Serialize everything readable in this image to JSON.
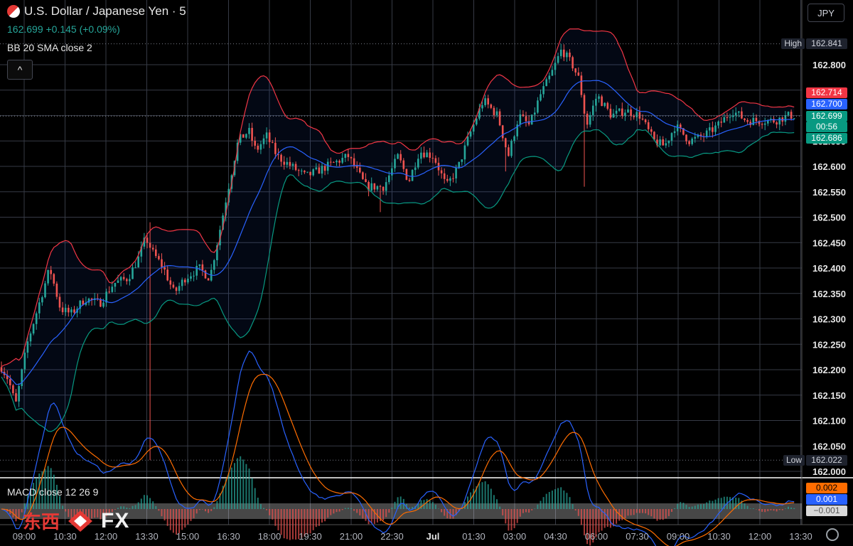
{
  "header": {
    "symbol": "U.S. Dollar / Japanese Yen · 5",
    "quote": "162.699 +0.145 (+0.09%)",
    "indicator": "BB 20 SMA close 2",
    "macd_label": "MACD close 12 26 9",
    "currency": "JPY",
    "collapse_glyph": "^"
  },
  "price_axis": {
    "ticks": [
      "162.800",
      "162.750",
      "162.700",
      "162.650",
      "162.600",
      "162.550",
      "162.500",
      "162.450",
      "162.400",
      "162.350",
      "162.300",
      "162.250",
      "162.200",
      "162.150",
      "162.100",
      "162.050",
      "162.000"
    ],
    "high_label": "High",
    "high_value": "162.841",
    "low_label": "Low",
    "low_value": "162.022",
    "bb_upper_tag": "162.714",
    "bb_basis_tag": "162.700",
    "last_price_tag": "162.699",
    "countdown": "00:56",
    "bb_lower_tag": "162.686"
  },
  "macd_axis": {
    "signal_tag": "0.002",
    "macd_tag": "0.001",
    "hist_tag": "−0.001"
  },
  "time_axis": {
    "ticks": [
      "09:00",
      "10:30",
      "12:00",
      "13:30",
      "15:00",
      "16:30",
      "18:00",
      "19:30",
      "21:00",
      "22:30",
      "Jul",
      "01:30",
      "03:00",
      "04:30",
      "06:00",
      "07:30",
      "09:00",
      "10:30",
      "12:00",
      "13:30"
    ]
  },
  "colors": {
    "up": "#26a69a",
    "down": "#ef5350",
    "bb_upper": "#f23645",
    "bb_basis": "#2962ff",
    "bb_lower": "#089981",
    "macd_line": "#2962ff",
    "signal_line": "#ff6d00",
    "grid": "#363a45"
  },
  "watermark": {
    "cn": "东西",
    "fx": "FX"
  },
  "chart_data": {
    "type": "candlestick",
    "interval": "5",
    "title": "U.S. Dollar / Japanese Yen · 5",
    "ylim": [
      162.0,
      162.85
    ],
    "high": 162.841,
    "low": 162.022,
    "last": 162.699,
    "change": "+0.145 (+0.09%)",
    "anchors": [
      [
        0,
        162.21
      ],
      [
        12,
        162.18
      ],
      [
        22,
        162.13
      ],
      [
        38,
        162.25
      ],
      [
        55,
        162.33
      ],
      [
        70,
        162.4
      ],
      [
        85,
        162.32
      ],
      [
        100,
        162.31
      ],
      [
        120,
        162.34
      ],
      [
        140,
        162.33
      ],
      [
        160,
        162.37
      ],
      [
        180,
        162.38
      ],
      [
        195,
        162.42
      ],
      [
        205,
        162.46
      ],
      [
        215,
        162.43
      ],
      [
        230,
        162.4
      ],
      [
        245,
        162.35
      ],
      [
        260,
        162.38
      ],
      [
        280,
        162.4
      ],
      [
        295,
        162.38
      ],
      [
        310,
        162.48
      ],
      [
        320,
        162.55
      ],
      [
        335,
        162.65
      ],
      [
        350,
        162.67
      ],
      [
        360,
        162.63
      ],
      [
        375,
        162.66
      ],
      [
        390,
        162.62
      ],
      [
        410,
        162.6
      ],
      [
        430,
        162.58
      ],
      [
        460,
        162.6
      ],
      [
        490,
        162.62
      ],
      [
        515,
        162.56
      ],
      [
        540,
        162.56
      ],
      [
        560,
        162.62
      ],
      [
        575,
        162.57
      ],
      [
        590,
        162.63
      ],
      [
        610,
        162.62
      ],
      [
        628,
        162.56
      ],
      [
        645,
        162.6
      ],
      [
        660,
        162.66
      ],
      [
        680,
        162.73
      ],
      [
        700,
        162.7
      ],
      [
        715,
        162.62
      ],
      [
        730,
        162.7
      ],
      [
        745,
        162.68
      ],
      [
        760,
        162.74
      ],
      [
        775,
        162.78
      ],
      [
        790,
        162.83
      ],
      [
        805,
        162.8
      ],
      [
        815,
        162.77
      ],
      [
        825,
        162.68
      ],
      [
        840,
        162.74
      ],
      [
        860,
        162.7
      ],
      [
        880,
        162.71
      ],
      [
        900,
        162.7
      ],
      [
        920,
        162.65
      ],
      [
        935,
        162.64
      ],
      [
        950,
        162.68
      ],
      [
        970,
        162.65
      ],
      [
        990,
        162.66
      ],
      [
        1010,
        162.68
      ],
      [
        1030,
        162.71
      ],
      [
        1050,
        162.69
      ],
      [
        1070,
        162.69
      ],
      [
        1090,
        162.69
      ],
      [
        1110,
        162.7
      ],
      [
        1122,
        162.7
      ]
    ]
  }
}
